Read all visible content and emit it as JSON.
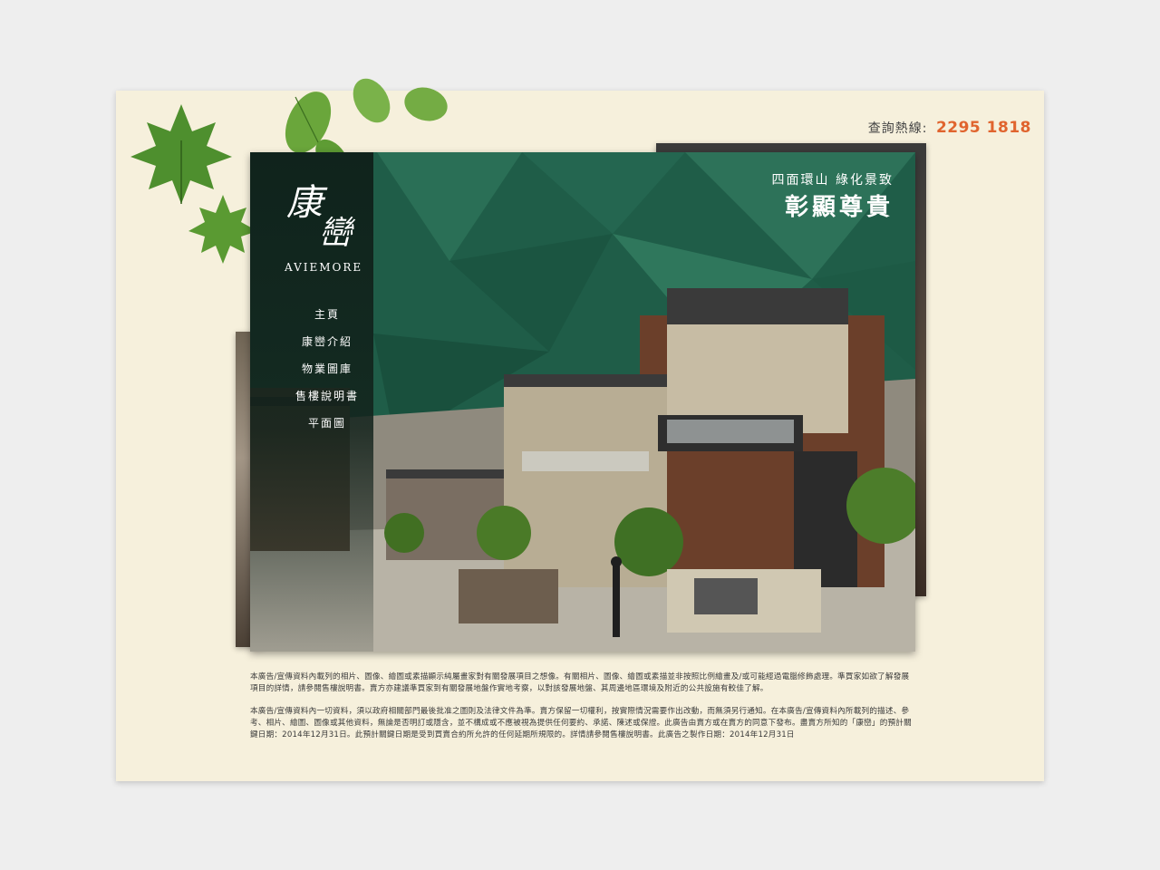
{
  "hotline": {
    "label": "查詢熱線:",
    "number": "2295 1818"
  },
  "logo": {
    "cn_char1": "康",
    "cn_char2": "巒",
    "en": "AVIEMORE"
  },
  "nav": {
    "items": [
      {
        "label": "主頁"
      },
      {
        "label": "康巒介紹"
      },
      {
        "label": "物業圖庫"
      },
      {
        "label": "售樓說明書"
      },
      {
        "label": "平面圖"
      }
    ]
  },
  "tagline": {
    "sub": "四面環山 綠化景致",
    "main": "彰顯尊貴"
  },
  "disclaimer": {
    "para1": "本廣告/宣傳資料內載列的相片、圖像、繪圖或素描顯示純屬畫家對有關發展項目之想像。有關相片、圖像、繪圖或素描並非按照比例繪畫及/或可能經過電腦修飾處理。準買家如欲了解發展項目的詳情，請參閱售樓說明書。賣方亦建議準買家到有關發展地盤作實地考察，以對該發展地盤、其周邊地區環境及附近的公共設施有較佳了解。",
    "para2": "本廣告/宣傳資料內一切資料，須以政府相關部門最後批准之圖則及法律文件為準。賣方保留一切權利，按實際情況需要作出改動，而無須另行通知。在本廣告/宣傳資料內所載列的描述、參考、相片、繪圖、圖像或其他資料，無論是否明訂或隱含，並不構成或不應被視為提供任何要約、承諾、陳述或保證。此廣告由賣方或在賣方的同意下發布。盡賣方所知的「康巒」的預計關鍵日期：2014年12月31日。此預計關鍵日期是受到買賣合約所允許的任何延期所規限的。詳情請參閱售樓說明書。此廣告之製作日期：2014年12月31日"
  },
  "colors": {
    "accent": "#e0642e",
    "hero_green": "#1e5a46",
    "page_bg": "#f6f0dc"
  }
}
